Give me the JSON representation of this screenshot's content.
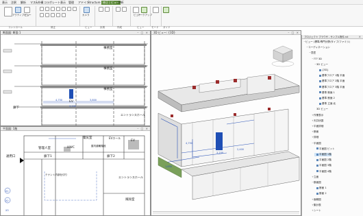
{
  "menu": {
    "items": [
      "表示",
      "注釈",
      "解析",
      "マス&外構",
      "コラボレート",
      "表示",
      "管理",
      "アドイン",
      "Structure",
      "修正 | ビュー",
      "ONE"
    ],
    "active_index": 9
  },
  "ribbon": {
    "groups": [
      "コントロール",
      "修正",
      "ビュー",
      "計測",
      "作成",
      "ビュー",
      "モード",
      "ガイド"
    ],
    "buttons": [
      "アクティブビュー",
      "ピン",
      "カメラ",
      "ビュー",
      "マークアップ",
      "書き出し",
      "終了",
      "カラー"
    ]
  },
  "left_top_view": {
    "title": "断面図: 断面 1",
    "labels": [
      "事務室",
      "事務室",
      "事務室",
      "廊下",
      "EV",
      "エントランスホール",
      "設備室",
      "ホール"
    ],
    "dims": [
      "4,750",
      "3,800",
      "5,200"
    ]
  },
  "plan_view": {
    "title": "平面図: 1階",
    "rooms": [
      "管理人室",
      "HWC",
      "廊下1",
      "廊下2",
      "通用口",
      "テナント内部仕切り",
      "エントランスホール",
      "風除室",
      "EVホール",
      "EV",
      "電気室",
      "屋内避難階段"
    ],
    "grid": [
      "X1",
      "X2",
      "X3"
    ]
  },
  "view_3d": {
    "title": "3D ビュー: {3D}",
    "dims": [
      "4,750",
      "3,200",
      "2,400",
      "1,850"
    ]
  },
  "browser": {
    "title": "プロジェクト ブラウザ - サンプル物件.rvt",
    "items": [
      {
        "label": "ビュー (標準/専門分野/タイプ/ファミリ)",
        "depth": 0,
        "state": "open"
      },
      {
        "label": "コーディネーション",
        "depth": 1,
        "state": "open"
      },
      {
        "label": "意匠",
        "depth": 2,
        "state": "open"
      },
      {
        "label": "??? 3D",
        "depth": 3,
        "state": "open"
      },
      {
        "label": "3D ビュー",
        "depth": 4,
        "state": "open"
      },
      {
        "label": "{3D}",
        "depth": 5,
        "state": "leaf",
        "icon": true
      },
      {
        "label": "基準フロア 1階 平面",
        "depth": 5,
        "state": "leaf",
        "icon": true
      },
      {
        "label": "基準フロア 2階 平面",
        "depth": 5,
        "state": "leaf",
        "icon": true
      },
      {
        "label": "基準フロア 3階 平面",
        "depth": 5,
        "state": "leaf",
        "icon": true
      },
      {
        "label": "基準 断面 1",
        "depth": 5,
        "state": "leaf",
        "icon": true
      },
      {
        "label": "基準 断面 2",
        "depth": 5,
        "state": "leaf",
        "icon": true
      },
      {
        "label": "基準 立面 北",
        "depth": 5,
        "state": "leaf",
        "icon": true
      },
      {
        "label": "3D ビュー",
        "depth": 4,
        "state": "leaf"
      },
      {
        "label": "作業表示",
        "depth": 3,
        "state": "closed"
      },
      {
        "label": "天井伏図",
        "depth": 3,
        "state": "closed"
      },
      {
        "label": "平面詳細",
        "depth": 3,
        "state": "closed"
      },
      {
        "label": "断面",
        "depth": 3,
        "state": "closed"
      },
      {
        "label": "詳細",
        "depth": 3,
        "state": "closed"
      },
      {
        "label": "平面図",
        "depth": 3,
        "state": "open"
      },
      {
        "label": "平面図 ピット",
        "depth": 4,
        "state": "leaf",
        "icon": true
      },
      {
        "label": "平面図 1階",
        "depth": 4,
        "state": "leaf",
        "icon": true,
        "selected": true
      },
      {
        "label": "平面図 2階",
        "depth": 4,
        "state": "leaf",
        "icon": true
      },
      {
        "label": "平面図 3階",
        "depth": 4,
        "state": "leaf",
        "icon": true
      },
      {
        "label": "平面図 4階",
        "depth": 4,
        "state": "leaf",
        "icon": true
      },
      {
        "label": "立面",
        "depth": 3,
        "state": "closed"
      },
      {
        "label": "断面図",
        "depth": 3,
        "state": "open"
      },
      {
        "label": "断面 1",
        "depth": 4,
        "state": "leaf",
        "icon": true
      },
      {
        "label": "断面 2",
        "depth": 4,
        "state": "leaf",
        "icon": true
      },
      {
        "label": "面積図",
        "depth": 3,
        "state": "closed"
      },
      {
        "label": "集計表",
        "depth": 3,
        "state": "closed"
      },
      {
        "label": "シート",
        "depth": 3,
        "state": "closed"
      }
    ]
  }
}
